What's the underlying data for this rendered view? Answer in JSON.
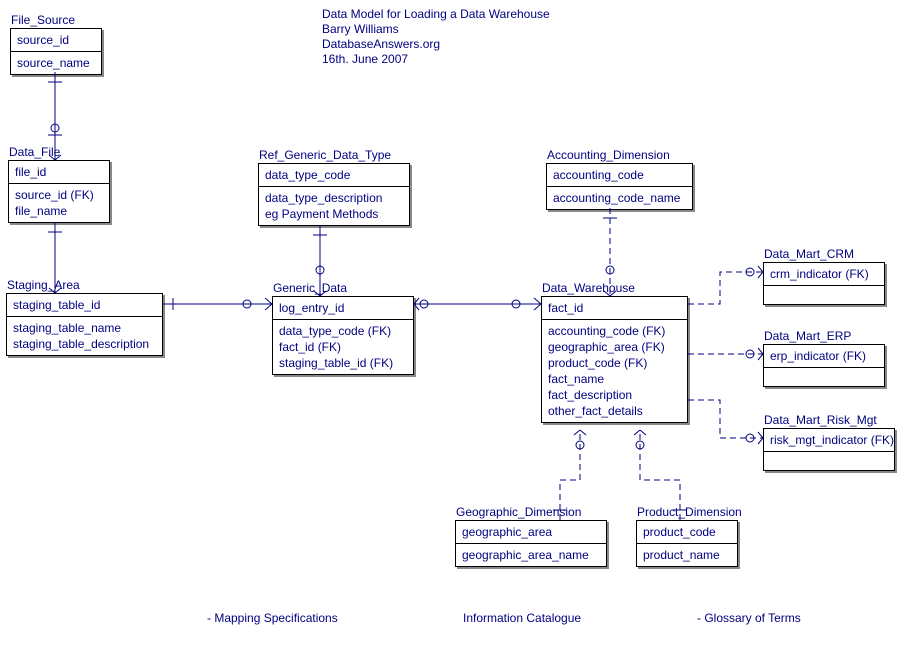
{
  "header": {
    "title": "Data Model for Loading a Data Warehouse",
    "author": "Barry Williams",
    "site": "DatabaseAnswers.org",
    "date": "16th. June 2007"
  },
  "entities": {
    "file_source": {
      "name": "File_Source",
      "pk": [
        "source_id"
      ],
      "attrs": [
        "source_name"
      ]
    },
    "data_file": {
      "name": "Data_File",
      "pk": [
        "file_id"
      ],
      "attrs": [
        "source_id (FK)",
        "file_name"
      ]
    },
    "staging_area": {
      "name": "Staging_Area",
      "pk": [
        "staging_table_id"
      ],
      "attrs": [
        "staging_table_name",
        "staging_table_description"
      ]
    },
    "ref_generic_data_type": {
      "name": "Ref_Generic_Data_Type",
      "pk": [
        "data_type_code"
      ],
      "attrs": [
        "data_type_description",
        "eg Payment Methods"
      ]
    },
    "generic_data": {
      "name": "Generic_Data",
      "pk": [
        "log_entry_id"
      ],
      "attrs": [
        "data_type_code (FK)",
        "fact_id (FK)",
        "staging_table_id (FK)"
      ]
    },
    "accounting_dimension": {
      "name": "Accounting_Dimension",
      "pk": [
        "accounting_code"
      ],
      "attrs": [
        "accounting_code_name"
      ]
    },
    "data_warehouse": {
      "name": "Data_Warehouse",
      "pk": [
        "fact_id"
      ],
      "attrs": [
        "accounting_code (FK)",
        "geographic_area (FK)",
        "product_code (FK)",
        "fact_name",
        "fact_description",
        "other_fact_details"
      ]
    },
    "data_mart_crm": {
      "name": "Data_Mart_CRM",
      "pk": [
        "crm_indicator (FK)"
      ],
      "attrs": []
    },
    "data_mart_erp": {
      "name": "Data_Mart_ERP",
      "pk": [
        "erp_indicator (FK)"
      ],
      "attrs": []
    },
    "data_mart_risk_mgt": {
      "name": "Data_Mart_Risk_Mgt",
      "pk": [
        "risk_mgt_indicator (FK)"
      ],
      "attrs": []
    },
    "geographic_dimension": {
      "name": "Geographic_Dimension",
      "pk": [
        "geographic_area"
      ],
      "attrs": [
        "geographic_area_name"
      ]
    },
    "product_dimension": {
      "name": "Product_Dimension",
      "pk": [
        "product_code"
      ],
      "attrs": [
        "product_name"
      ]
    }
  },
  "footer": {
    "mapping": "- Mapping Specifications",
    "catalogue": "Information Catalogue",
    "glossary": "- Glossary of Terms"
  }
}
